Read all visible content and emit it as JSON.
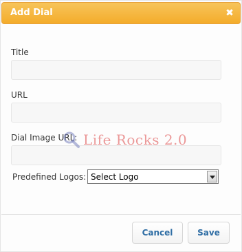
{
  "dialog": {
    "title": "Add Dial",
    "close_icon": "close-icon"
  },
  "form": {
    "title_label": "Title",
    "title_value": "",
    "url_label": "URL",
    "url_value": "",
    "dial_image_url_label": "Dial Image URL:",
    "dial_image_url_value": "",
    "predefined_logos_label": "Predefined Logos:",
    "predefined_logos_selected": "Select Logo"
  },
  "watermark": {
    "text": "Life Rocks 2.0",
    "icon": "magnifier-icon"
  },
  "buttons": {
    "cancel_label": "Cancel",
    "save_label": "Save"
  },
  "colors": {
    "titlebar": "#f4ac2b",
    "button_text": "#2e6da4"
  }
}
